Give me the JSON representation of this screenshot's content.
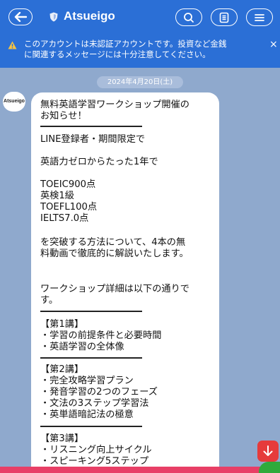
{
  "header": {
    "title": "Atsueigo"
  },
  "warning": {
    "text_line1": "このアカウントは未認証アカウントです。投資など金銭",
    "text_line2": "に関連するメッセージには十分注意してください。",
    "close": "×"
  },
  "date": "2024年4月20日(土)",
  "avatar_text": "Atsueigo",
  "message": {
    "lines": [
      "無料英語学習ワークショップ開催の",
      "お知らせ！",
      "LINE登録者・期間限定で",
      "英語力ゼロからたった1年で",
      "TOEIC900点",
      "英検1級",
      "TOEFL100点",
      "IELTS7.0点",
      "を突破する方法について、4本の無",
      "料動画で徹底的に解説いたします。",
      "ワークショップ詳細は以下の通りで",
      "す。",
      "【第1講】",
      "・学習の前提条件と必要時間",
      "・英語学習の全体像",
      "【第2講】",
      "・完全攻略学習プラン",
      "・発音学習の2つのフェーズ",
      "・文法の3ステップ学習法",
      "・英単語暗記法の極意",
      "【第3講】",
      "・リスニング向上サイクル",
      "・スピーキング5ステップ"
    ]
  },
  "colors": {
    "header_blue": "#2b6fd6",
    "chat_bg": "#8fa9cd",
    "scroll_red": "#e63b3b"
  },
  "icons": {
    "back": "arrow-left-icon",
    "verified": "shield-icon",
    "search": "search-icon",
    "notes": "note-icon",
    "menu": "menu-icon",
    "warning": "warning-icon",
    "scroll": "arrow-down-icon"
  }
}
